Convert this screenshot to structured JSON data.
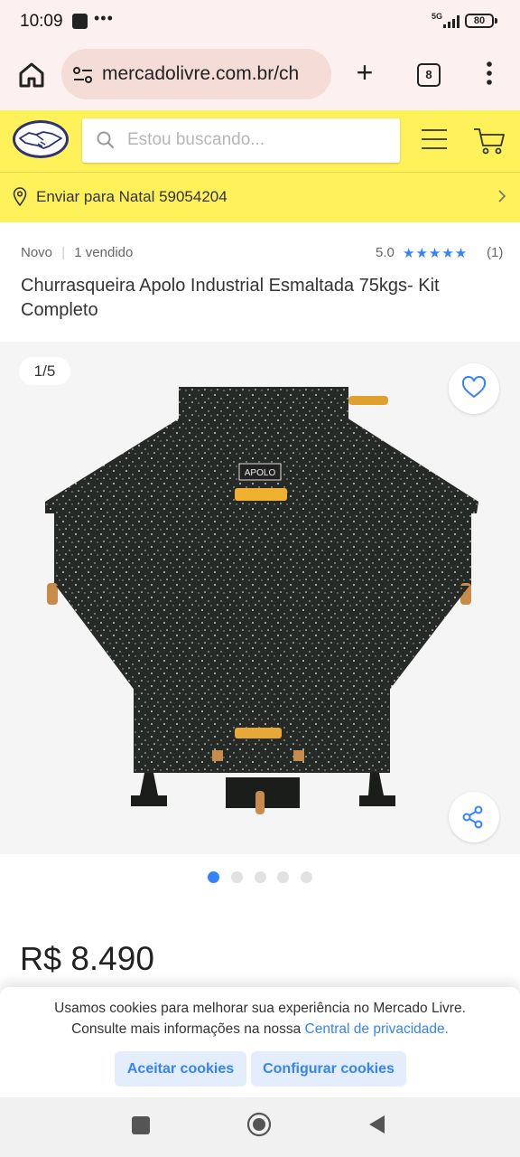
{
  "status": {
    "time": "10:09",
    "network": "5G",
    "battery": "80"
  },
  "browser": {
    "url": "mercadolivre.com.br/ch",
    "tab_count": "8"
  },
  "header": {
    "search_placeholder": "Estou buscando...",
    "delivery_text": "Enviar para Natal 59054204"
  },
  "product": {
    "condition": "Novo",
    "separator": "|",
    "sold": "1 vendido",
    "rating": "5.0",
    "stars": "★★★★★",
    "reviews": "(1)",
    "title": "Churrasqueira Apolo Industrial Esmaltada 75kgs- Kit Completo",
    "image_counter": "1/5",
    "image_index": 1,
    "image_total": 5,
    "price_currency": "R$",
    "price_value": "8.490",
    "brand_plate": "APOLO"
  },
  "cookie": {
    "text_line1": "Usamos cookies para melhorar sua experiência no Mercado Livre.",
    "text_line2": "Consulte mais informações na nossa",
    "link": "Central de privacidade",
    "link_end": ".",
    "accept_label": "Aceitar cookies",
    "config_label": "Configurar cookies"
  },
  "colors": {
    "accent": "#3483fa",
    "header_yellow": "#fff159",
    "browser_bg": "#fdf1ef"
  }
}
